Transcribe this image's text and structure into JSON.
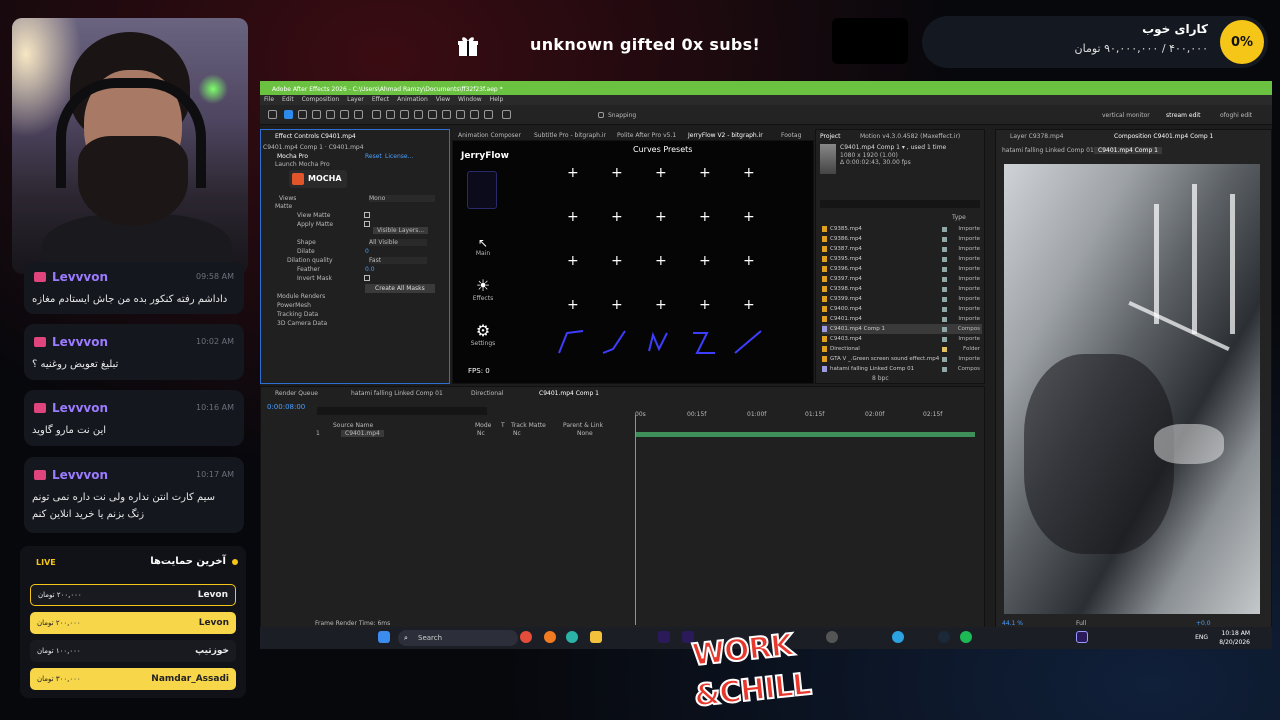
{
  "banner": {
    "gift_text": "unknown gifted 0x subs!"
  },
  "goal": {
    "percent": "0%",
    "title": "کارای خوب",
    "amount": "۴۰۰,۰۰۰ / ۹۰,۰۰۰,۰۰۰ تومان"
  },
  "chat": [
    {
      "user": "Levvvon",
      "time": "09:58 AM",
      "text": "داداشم رفته کنکور بده من جاش ایستادم مغازه"
    },
    {
      "user": "Levvvon",
      "time": "10:02 AM",
      "text": "تبلیغ تعویض روغنیه ؟"
    },
    {
      "user": "Levvvon",
      "time": "10:16 AM",
      "text": "این نت مارو گاوید"
    },
    {
      "user": "Levvvon",
      "time": "10:17 AM",
      "text": "سیم کارت انتن نداره ولی نت داره نمی تونم زنگ بزنم یا خرید انلاین کنم"
    }
  ],
  "support": {
    "title": "آخرین حمایت‌ها",
    "live": "LIVE",
    "rows": [
      {
        "name": "Levon",
        "amount": "۲۰۰,۰۰۰ تومان"
      },
      {
        "name": "Levon",
        "amount": "۲۰۰,۰۰۰ تومان"
      },
      {
        "name": "خوزتیپ",
        "amount": "۱۰۰,۰۰۰ تومان"
      },
      {
        "name": "Namdar_Assadi",
        "amount": "۳۰۰,۰۰۰ تومان"
      }
    ]
  },
  "ae": {
    "title": "Adobe After Effects 2026 - C:\\Users\\Ahmad Ramzy\\Documents\\ff32f23f.aep *",
    "menu": [
      "File",
      "Edit",
      "Composition",
      "Layer",
      "Effect",
      "Animation",
      "View",
      "Window",
      "Help"
    ],
    "snapping": "Snapping",
    "workspaces": [
      "vertical monitor",
      "stream edit",
      "ofoghi edit"
    ],
    "effect_controls": {
      "tab": "Effect Controls C9401.mp4",
      "layer": "C9401.mp4 Comp 1 · C9401.mp4",
      "effect": "Mocha Pro",
      "reset": "Reset",
      "license": "License...",
      "launch": "Launch Mocha Pro",
      "mocha_label": "MOCHA",
      "views_label": "Views",
      "views_value": "Mono",
      "matte": "Matte",
      "view_matte": "View Matte",
      "apply_matte": "Apply Matte",
      "visible_layers": "Visible Layers...",
      "shape": "Shape",
      "shape_value": "All Visible",
      "dilate": "Dilate",
      "dilate_value": "0",
      "dilation_quality": "Dilation quality",
      "dilation_value": "Fast",
      "feather": "Feather",
      "feather_value": "0.0",
      "invert_mask": "Invert Mask",
      "create_masks": "Create All Masks",
      "sections": [
        "Module Renders",
        "PowerMesh",
        "Tracking Data",
        "3D Camera Data"
      ]
    },
    "panel_tabs": [
      "Animation Composer",
      "Subtitle Pro - bitgraph.ir",
      "Polite After Pro v5.1",
      "JerryFlow V2 - bitgraph.ir",
      "Footag"
    ],
    "jerryflow": {
      "logo": "JerryFlow",
      "title": "Curves Presets",
      "main": "Main",
      "effects": "Effects",
      "settings": "Settings",
      "fps": "FPS: 0"
    },
    "project": {
      "tab": "Project",
      "tab2": "Motion v4.3.0.4582 (Maxeffect.ir)",
      "info1": "C9401.mp4 Comp 1 ▾ , used 1 time",
      "info2": "1080 x 1920 (1.00)",
      "info3": "Δ 0:00:02:43, 30.00 fps",
      "type_header": "Type",
      "items": [
        {
          "name": "C9385.mp4",
          "type": "Importe"
        },
        {
          "name": "C9386.mp4",
          "type": "Importe"
        },
        {
          "name": "C9387.mp4",
          "type": "Importe"
        },
        {
          "name": "C9395.mp4",
          "type": "Importe"
        },
        {
          "name": "C9396.mp4",
          "type": "Importe"
        },
        {
          "name": "C9397.mp4",
          "type": "Importe"
        },
        {
          "name": "C9398.mp4",
          "type": "Importe"
        },
        {
          "name": "C9399.mp4",
          "type": "Importe"
        },
        {
          "name": "C9400.mp4",
          "type": "Importe"
        },
        {
          "name": "C9401.mp4",
          "type": "Importe"
        },
        {
          "name": "C9401.mp4 Comp 1",
          "type": "Compos"
        },
        {
          "name": "C9403.mp4",
          "type": "Importe"
        },
        {
          "name": "Directional",
          "type": "Folder"
        },
        {
          "name": "GTA V _.Green screen sound effect.mp4",
          "type": "Importe"
        },
        {
          "name": "hatami falling Linked Comp 01",
          "type": "Compos"
        }
      ],
      "bpc": "8 bpc"
    },
    "viewer": {
      "tab1": "Layer C9378.mp4",
      "tab2": "Composition C9401.mp4 Comp 1",
      "sub1": "hatami falling Linked Comp 01",
      "sub2": "C9401.mp4 Comp 1",
      "zoom": "44.1 %",
      "quality": "Full",
      "offset": "+0.0"
    },
    "timeline": {
      "tabs": [
        "Render Queue",
        "hatami falling Linked Comp 01",
        "Directional",
        "C9401.mp4 Comp 1"
      ],
      "time": "0:00:08:00",
      "ticks": [
        "00s",
        "00:15f",
        "01:00f",
        "01:15f",
        "02:00f",
        "02:15f"
      ],
      "cols": [
        "Source Name",
        "Mode",
        "T",
        "Track Matte",
        "Parent & Link"
      ],
      "layer_num": "1",
      "layer_name": "C9401.mp4",
      "mode": "Nc",
      "matte": "Nc",
      "parent": "None",
      "render_time": "Frame Render Time: 6ms"
    }
  },
  "taskbar": {
    "search": "Search",
    "lang": "ENG",
    "time": "10:18 AM",
    "date": "8/20/2026"
  },
  "logo": {
    "line1": "WORK",
    "line2": "&CHILL"
  }
}
